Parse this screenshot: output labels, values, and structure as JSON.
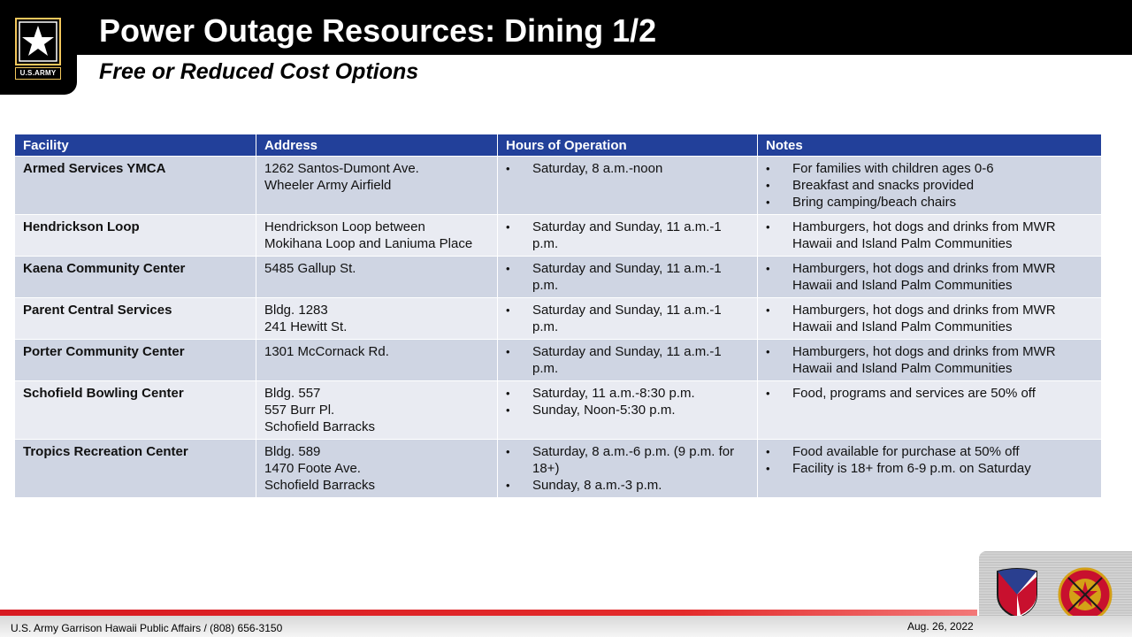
{
  "header": {
    "title": "Power Outage Resources: Dining 1/2",
    "subtitle": "Free or Reduced Cost Options",
    "logo_text": "U.S.ARMY"
  },
  "table": {
    "headers": [
      "Facility",
      "Address",
      "Hours of Operation",
      "Notes"
    ],
    "rows": [
      {
        "facility": "Armed Services YMCA",
        "address": [
          "1262 Santos-Dumont Ave.",
          "Wheeler Army Airfield"
        ],
        "hours": [
          "Saturday, 8 a.m.-noon"
        ],
        "notes": [
          "For families with children ages 0-6",
          "Breakfast and snacks provided",
          "Bring camping/beach chairs"
        ]
      },
      {
        "facility": "Hendrickson Loop",
        "address": [
          "Hendrickson Loop between",
          "Mokihana Loop and Laniuma Place"
        ],
        "hours": [
          "Saturday and Sunday, 11 a.m.-1 p.m."
        ],
        "notes": [
          "Hamburgers, hot dogs and drinks from MWR Hawaii and Island Palm Communities"
        ]
      },
      {
        "facility": "Kaena Community Center",
        "address": [
          "5485 Gallup St."
        ],
        "hours": [
          "Saturday and Sunday, 11 a.m.-1 p.m."
        ],
        "notes": [
          "Hamburgers, hot dogs and drinks from MWR Hawaii and Island Palm Communities"
        ]
      },
      {
        "facility": "Parent Central Services",
        "address": [
          "Bldg. 1283",
          "241 Hewitt St."
        ],
        "hours": [
          "Saturday and Sunday, 11 a.m.-1 p.m."
        ],
        "notes": [
          "Hamburgers, hot dogs and drinks from MWR Hawaii and Island Palm Communities"
        ]
      },
      {
        "facility": "Porter Community Center",
        "address": [
          "1301 McCornack Rd."
        ],
        "hours": [
          "Saturday and Sunday, 11 a.m.-1 p.m."
        ],
        "notes": [
          "Hamburgers, hot dogs and drinks from MWR Hawaii and Island Palm Communities"
        ]
      },
      {
        "facility": "Schofield Bowling Center",
        "address": [
          "Bldg. 557",
          "557 Burr Pl.",
          "Schofield Barracks"
        ],
        "hours": [
          "Saturday, 11 a.m.-8:30 p.m.",
          "Sunday, Noon-5:30 p.m."
        ],
        "notes": [
          "Food, programs and services are 50% off"
        ]
      },
      {
        "facility": "Tropics Recreation Center",
        "address": [
          "Bldg. 589",
          "1470 Foote Ave.",
          "Schofield Barracks"
        ],
        "hours": [
          "Saturday, 8 a.m.-6 p.m. (9 p.m. for 18+)",
          "Sunday, 8 a.m.-3 p.m."
        ],
        "notes": [
          "Food available for purchase at 50% off",
          "Facility is 18+ from 6-9 p.m. on Saturday"
        ]
      }
    ]
  },
  "footer": {
    "contact": "U.S. Army Garrison Hawaii Public Affairs / (808) 656-3150",
    "date": "Aug. 26, 2022"
  },
  "colors": {
    "header_bg": "#000000",
    "table_header_bg": "#22409a",
    "row_odd": "#cfd5e3",
    "row_even": "#e9ebf2",
    "footer_stripe": "#d71920"
  },
  "icons": {
    "army_logo": "army-star-icon",
    "imcom_emblem": "shield-emblem-icon",
    "garrison_emblem": "garrison-insignia-icon"
  }
}
